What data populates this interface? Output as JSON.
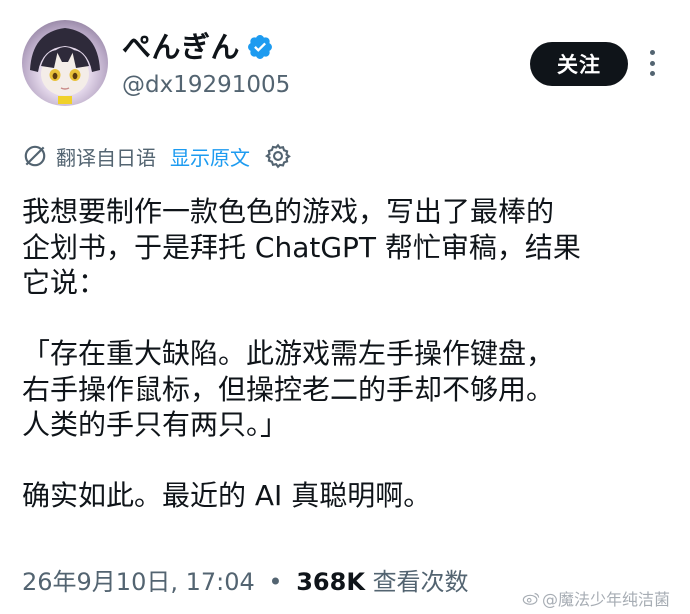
{
  "profile": {
    "display_name": "ぺんぎん",
    "handle": "@dx19291005",
    "verified": true
  },
  "actions": {
    "follow_label": "关注"
  },
  "translation": {
    "label": "翻译自日语",
    "show_original": "显示原文"
  },
  "tweet": {
    "lines": [
      "我想要制作一款色色的游戏，写出了最棒的",
      "企划书，于是拜托 ChatGPT 帮忙审稿，结果",
      "它说：",
      "",
      "「存在重大缺陷。此游戏需左手操作键盘，",
      "右手操作鼠标，但操控老二的手却不够用。",
      "人类的手只有两只。」",
      "",
      "确实如此。最近的 AI 真聪明啊。"
    ]
  },
  "meta": {
    "datetime": "26年9月10日, 17:04",
    "separator": "•",
    "views_count": "368K",
    "views_label": "查看次数"
  },
  "watermark": {
    "text": "@魔法少年纯洁菌"
  },
  "colors": {
    "text": "#0f1419",
    "secondary": "#536471",
    "link": "#1d9bf0",
    "button_bg": "#0f1419",
    "button_text": "#ffffff"
  }
}
